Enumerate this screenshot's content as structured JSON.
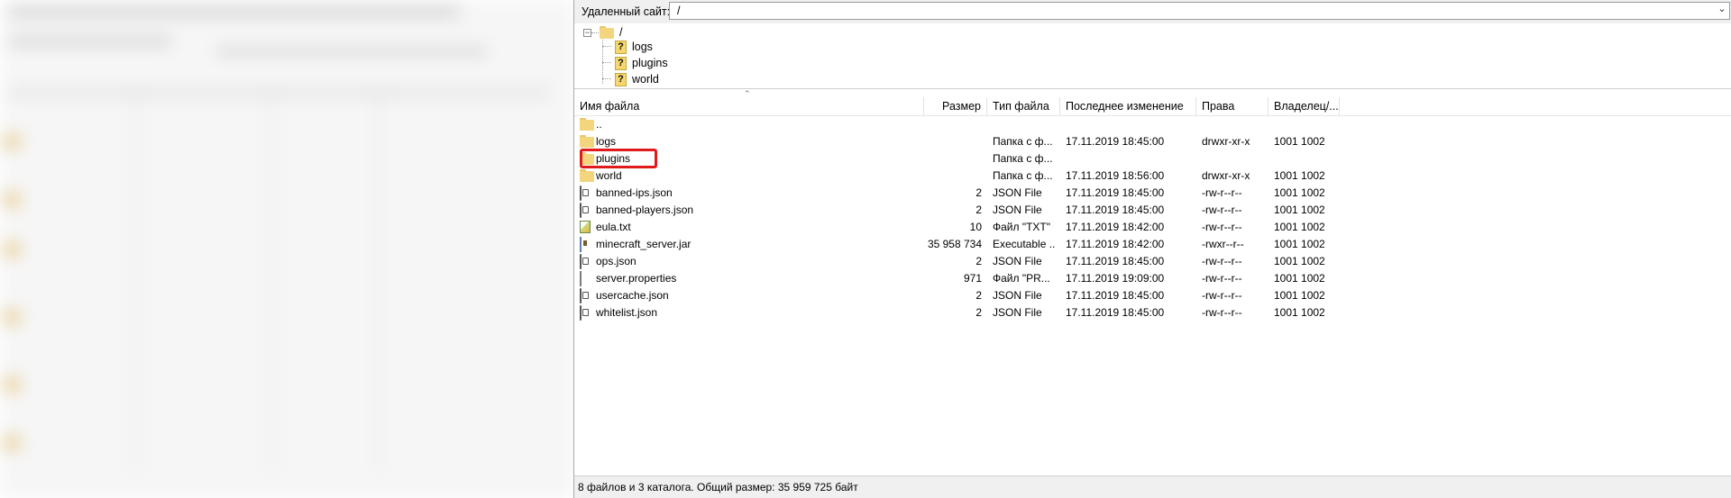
{
  "remote_site": {
    "label": "Удаленный сайт:",
    "path": "/"
  },
  "tree": {
    "root": "/",
    "children": [
      "logs",
      "plugins",
      "world"
    ]
  },
  "columns": {
    "name": "Имя файла",
    "size": "Размер",
    "type": "Тип файла",
    "modified": "Последнее изменение",
    "perms": "Права",
    "owner": "Владелец/..."
  },
  "files": [
    {
      "icon": "folder-icon",
      "name": "..",
      "size": "",
      "type": "",
      "modified": "",
      "perms": "",
      "owner": ""
    },
    {
      "icon": "folder-icon",
      "name": "logs",
      "size": "",
      "type": "Папка с ф...",
      "modified": "17.11.2019 18:45:00",
      "perms": "drwxr-xr-x",
      "owner": "1001 1002"
    },
    {
      "icon": "folder-icon",
      "name": "plugins",
      "size": "",
      "type": "Папка с ф...",
      "modified": "",
      "perms": "",
      "owner": ""
    },
    {
      "icon": "folder-icon",
      "name": "world",
      "size": "",
      "type": "Папка с ф...",
      "modified": "17.11.2019 18:56:00",
      "perms": "drwxr-xr-x",
      "owner": "1001 1002"
    },
    {
      "icon": "json-file-icon",
      "name": "banned-ips.json",
      "size": "2",
      "type": "JSON File",
      "modified": "17.11.2019 18:45:00",
      "perms": "-rw-r--r--",
      "owner": "1001 1002"
    },
    {
      "icon": "json-file-icon",
      "name": "banned-players.json",
      "size": "2",
      "type": "JSON File",
      "modified": "17.11.2019 18:45:00",
      "perms": "-rw-r--r--",
      "owner": "1001 1002"
    },
    {
      "icon": "text-file-icon",
      "name": "eula.txt",
      "size": "10",
      "type": "Файл \"TXT\"",
      "modified": "17.11.2019 18:42:00",
      "perms": "-rw-r--r--",
      "owner": "1001 1002"
    },
    {
      "icon": "jar-file-icon",
      "name": "minecraft_server.jar",
      "size": "35 958 734",
      "type": "Executable ...",
      "modified": "17.11.2019 18:42:00",
      "perms": "-rwxr--r--",
      "owner": "1001 1002"
    },
    {
      "icon": "json-file-icon",
      "name": "ops.json",
      "size": "2",
      "type": "JSON File",
      "modified": "17.11.2019 18:45:00",
      "perms": "-rw-r--r--",
      "owner": "1001 1002"
    },
    {
      "icon": "document-icon",
      "name": "server.properties",
      "size": "971",
      "type": "Файл \"PR...",
      "modified": "17.11.2019 19:09:00",
      "perms": "-rw-r--r--",
      "owner": "1001 1002"
    },
    {
      "icon": "json-file-icon",
      "name": "usercache.json",
      "size": "2",
      "type": "JSON File",
      "modified": "17.11.2019 18:45:00",
      "perms": "-rw-r--r--",
      "owner": "1001 1002"
    },
    {
      "icon": "json-file-icon",
      "name": "whitelist.json",
      "size": "2",
      "type": "JSON File",
      "modified": "17.11.2019 18:45:00",
      "perms": "-rw-r--r--",
      "owner": "1001 1002"
    }
  ],
  "status": "8 файлов и 3 каталога. Общий размер: 35 959 725 байт",
  "highlight_color": "#e01b1b"
}
